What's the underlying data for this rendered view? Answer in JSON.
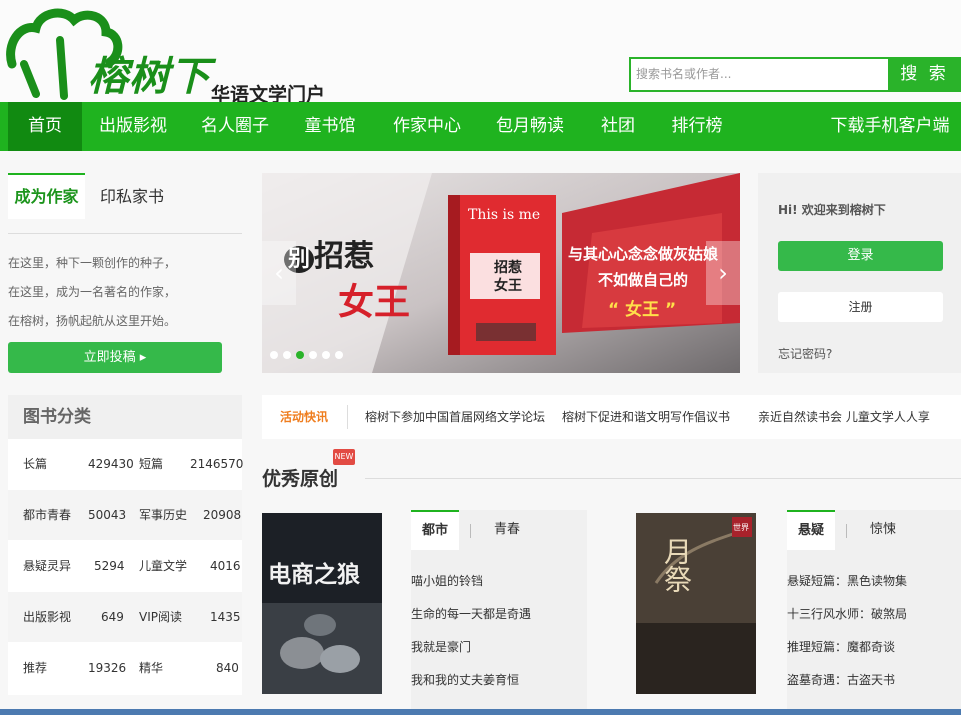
{
  "header": {
    "logo_text": "榕树下",
    "logo_sub": "华语文学门户",
    "search_placeholder": "搜索书名或作者...",
    "search_button": "搜 索"
  },
  "nav": {
    "items": [
      "首页",
      "出版影视",
      "名人圈子",
      "童书馆",
      "作家中心",
      "包月畅读",
      "社团",
      "排行榜"
    ],
    "download": "下载手机客户端"
  },
  "left": {
    "tab_author": "成为作家",
    "tab_print": "印私家书",
    "intro": [
      "在这里，种下一颗创作的种子，",
      "在这里，成为一名著名的作家，",
      "在榕树，扬帆起航从这里开始。"
    ],
    "submit_button": "立即投稿 ▸"
  },
  "categories": {
    "title": "图书分类",
    "rows": [
      {
        "a": "长篇",
        "a_count": "429430",
        "b": "短篇",
        "b_count": "2146570"
      },
      {
        "a": "都市青春",
        "a_count": "50043",
        "b": "军事历史",
        "b_count": "20908"
      },
      {
        "a": "悬疑灵异",
        "a_count": "5294",
        "b": "儿童文学",
        "b_count": "4016"
      },
      {
        "a": "出版影视",
        "a_count": "649",
        "b": "VIP阅读",
        "b_count": "1435"
      },
      {
        "a": "推荐",
        "a_count": "19326",
        "b": "精华",
        "b_count": "840"
      }
    ]
  },
  "banner": {
    "left_title_small": "别",
    "left_title_1": "招惹",
    "left_title_2": "女王",
    "book_en": "This is me",
    "book_cn_1": "招惹",
    "book_cn_2": "女王",
    "slogan_1": "与其心心念念做灰姑娘",
    "slogan_2": "不如做自己的",
    "slogan_3": "“ 女王 ”",
    "dots": 6,
    "active_dot": 3
  },
  "login": {
    "welcome": "Hi! 欢迎来到榕树下",
    "login": "登录",
    "register": "注册",
    "forgot": "忘记密码?"
  },
  "activity": {
    "label": "活动快讯",
    "items": [
      "榕树下参加中国首届网络文学论坛",
      "榕树下促进和谐文明写作倡议书",
      "亲近自然读书会 儿童文学人人享"
    ]
  },
  "featured": {
    "title": "优秀原创",
    "badge": "NEW",
    "book1_title": "电商之狼",
    "book2_title": "月祭",
    "book2_corner": "世界",
    "tabs_a": [
      "都市",
      "青春"
    ],
    "list_a": [
      "喵小姐的铃铛",
      "生命的每一天都是奇遇",
      "我就是豪门",
      "我和我的丈夫姜育恒"
    ],
    "tabs_b": [
      "悬疑",
      "惊悚"
    ],
    "list_b": [
      "悬疑短篇：黑色读物集",
      "十三行风水师：破煞局",
      "推理短篇：魔都奇谈",
      "盗墓奇遇：古盗天书"
    ]
  },
  "colors": {
    "brand_green": "#1fb31f",
    "nav_active": "#118a11",
    "accent_orange": "#ef7d1e"
  }
}
